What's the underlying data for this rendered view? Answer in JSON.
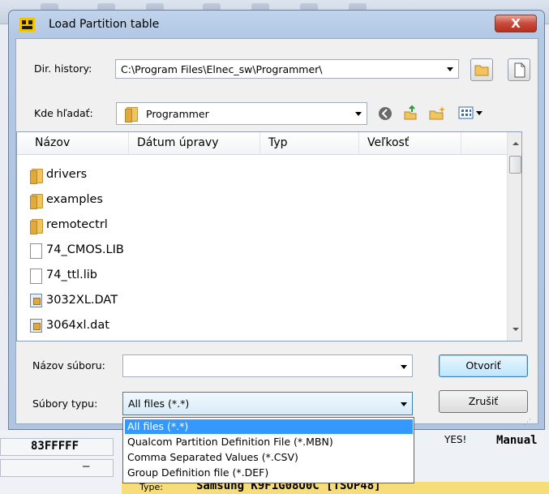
{
  "dialog": {
    "title": "Load Partition table",
    "close_label": "X"
  },
  "dir_history": {
    "label": "Dir. history:",
    "value": "C:\\Program Files\\Elnec_sw\\Programmer\\"
  },
  "look_in": {
    "label": "Kde hľadať:",
    "value": "Programmer"
  },
  "columns": [
    "Názov",
    "Dátum úpravy",
    "Typ",
    "Veľkosť"
  ],
  "files": [
    {
      "name": "drivers",
      "icon": "folder-icon"
    },
    {
      "name": "examples",
      "icon": "folder-icon"
    },
    {
      "name": "remotectrl",
      "icon": "folder-icon"
    },
    {
      "name": "74_CMOS.LIB",
      "icon": "document-icon"
    },
    {
      "name": "74_ttl.lib",
      "icon": "document-icon"
    },
    {
      "name": "3032XL.DAT",
      "icon": "data-file-icon"
    },
    {
      "name": "3064xl.dat",
      "icon": "data-file-icon"
    }
  ],
  "filename": {
    "label": "Názov súboru:",
    "value": ""
  },
  "filetype": {
    "label": "Súbory typu:",
    "value": "All files (*.*)",
    "options": [
      "All files (*.*)",
      "Qualcom Partition Definition File (*.MBN)",
      "Comma Separated Values (*.CSV)",
      "Group Definition file (*.DEF)"
    ]
  },
  "buttons": {
    "open": "Otvoriť",
    "cancel": "Zrušiť"
  },
  "background": {
    "hex_value": "83FFFFF",
    "dash": "–",
    "yes": "YES!",
    "manual": "Manual",
    "type_label": "Type:",
    "type_value": "Samsung K9F1G08U0C [TSOP48]"
  },
  "colors": {
    "selection": "#3399ff",
    "title_bar": "#b3c8e4"
  }
}
